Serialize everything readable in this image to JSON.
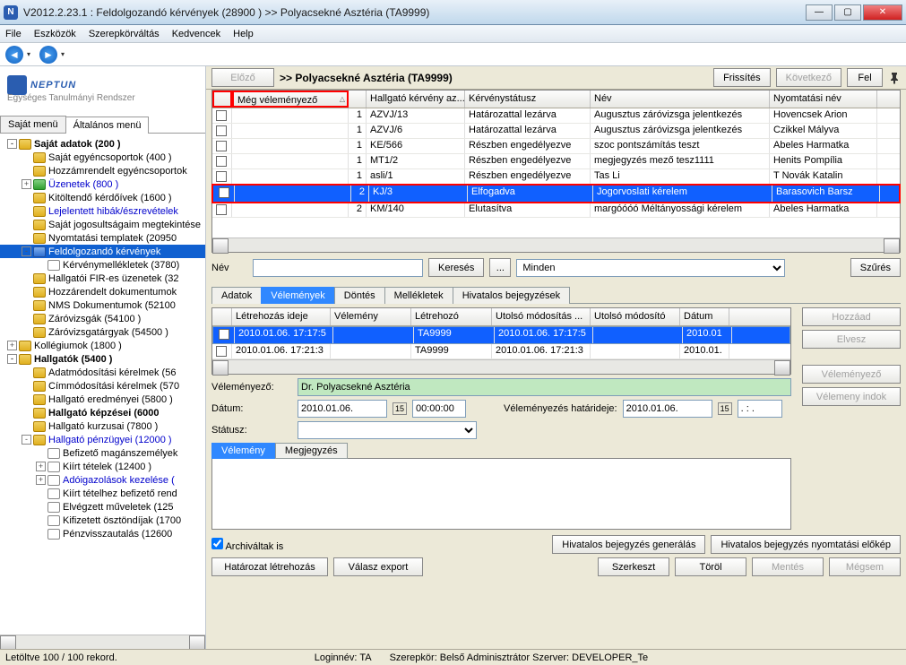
{
  "window": {
    "title": "V2012.2.23.1 : Feldolgozandó kérvények (28900  )  >> Polyacsekné Asztéria (TA9999)"
  },
  "menu": [
    "File",
    "Eszközök",
    "Szerepkörváltás",
    "Kedvencek",
    "Help"
  ],
  "logo": {
    "title": "NEPTUN",
    "sub": "Egységes Tanulmányi Rendszer"
  },
  "left_tabs": {
    "a": "Saját menü",
    "b": "Általános menü"
  },
  "tree": [
    {
      "d": 0,
      "exp": "-",
      "ico": "fld",
      "bold": true,
      "txt": "Saját adatok (200  )"
    },
    {
      "d": 1,
      "exp": "",
      "ico": "fld",
      "txt": "Saját egyéncsoportok (400  )"
    },
    {
      "d": 1,
      "exp": "",
      "ico": "fld",
      "txt": "Hozzámrendelt egyéncsoportok"
    },
    {
      "d": 1,
      "exp": "+",
      "ico": "green",
      "blue": true,
      "txt": "Üzenetek (800  )"
    },
    {
      "d": 1,
      "exp": "",
      "ico": "fld",
      "txt": "Kitöltendő kérdőívek (1600  )"
    },
    {
      "d": 1,
      "exp": "",
      "ico": "fld",
      "blue": true,
      "txt": "Lejelentett hibák/észrevételek"
    },
    {
      "d": 1,
      "exp": "",
      "ico": "fld",
      "txt": "Saját jogosultságaim megtekintése"
    },
    {
      "d": 1,
      "exp": "",
      "ico": "fld",
      "txt": "Nyomtatási templatek (20950"
    },
    {
      "d": 1,
      "exp": "-",
      "ico": "blue",
      "hl": true,
      "txt": "Feldolgozandó kérvények"
    },
    {
      "d": 2,
      "exp": "",
      "ico": "doc",
      "txt": "Kérvénymellékletek (3780)"
    },
    {
      "d": 1,
      "exp": "",
      "ico": "fld",
      "txt": "Hallgatói FIR-es üzenetek (32"
    },
    {
      "d": 1,
      "exp": "",
      "ico": "fld",
      "txt": "Hozzárendelt dokumentumok"
    },
    {
      "d": 1,
      "exp": "",
      "ico": "fld",
      "txt": "NMS Dokumentumok (52100"
    },
    {
      "d": 1,
      "exp": "",
      "ico": "fld",
      "txt": "Záróvizsgák (54100  )"
    },
    {
      "d": 1,
      "exp": "",
      "ico": "fld",
      "txt": "Záróvizsgatárgyak (54500  )"
    },
    {
      "d": 0,
      "exp": "+",
      "ico": "fld",
      "txt": "Kollégiumok (1800  )"
    },
    {
      "d": 0,
      "exp": "-",
      "ico": "fld",
      "bold": true,
      "txt": "Hallgatók (5400  )"
    },
    {
      "d": 1,
      "exp": "",
      "ico": "fld",
      "txt": "Adatmódosítási kérelmek (56"
    },
    {
      "d": 1,
      "exp": "",
      "ico": "fld",
      "txt": "Címmódosítási kérelmek (570"
    },
    {
      "d": 1,
      "exp": "",
      "ico": "fld",
      "txt": "Hallgató eredményei (5800  )"
    },
    {
      "d": 1,
      "exp": "",
      "ico": "fld",
      "bold": true,
      "txt": "Hallgató képzései (6000"
    },
    {
      "d": 1,
      "exp": "",
      "ico": "fld",
      "txt": "Hallgató kurzusai (7800  )"
    },
    {
      "d": 1,
      "exp": "-",
      "ico": "fld",
      "blue": true,
      "txt": "Hallgató pénzügyei (12000  )"
    },
    {
      "d": 2,
      "exp": "",
      "ico": "doc",
      "txt": "Befizető magánszemélyek"
    },
    {
      "d": 2,
      "exp": "+",
      "ico": "doc",
      "txt": "Kiírt tételek (12400  )"
    },
    {
      "d": 2,
      "exp": "+",
      "ico": "doc",
      "blue": true,
      "txt": "Adóigazolások kezelése ("
    },
    {
      "d": 2,
      "exp": "",
      "ico": "doc",
      "txt": "Kiírt tételhez befizető rend"
    },
    {
      "d": 2,
      "exp": "",
      "ico": "doc",
      "txt": "Elvégzett műveletek (125"
    },
    {
      "d": 2,
      "exp": "",
      "ico": "doc",
      "txt": "Kifizetett ösztöndíjak (1700"
    },
    {
      "d": 2,
      "exp": "",
      "ico": "doc",
      "txt": "Pénzvisszautalás (12600"
    }
  ],
  "top": {
    "prev": "Előző",
    "crumb": ">>  Polyacsekné Asztéria (TA9999)",
    "refresh": "Frissítés",
    "next": "Következő",
    "up": "Fel"
  },
  "grid": {
    "cols": [
      "",
      "Még véleményező",
      "",
      "Hallgató kérvény az...",
      "Kérvénystátusz",
      "Név",
      "Nyomtatási név"
    ],
    "rows": [
      [
        "",
        "",
        "1",
        "AZVJ/13",
        "Határozattal lezárva",
        "Augusztus záróvizsga jelentkezés",
        "Hovencsek Arion"
      ],
      [
        "",
        "",
        "1",
        "AZVJ/6",
        "Határozattal lezárva",
        "Augusztus záróvizsga jelentkezés",
        "Czikkel Mályva"
      ],
      [
        "",
        "",
        "1",
        "KE/566",
        "Részben engedélyezve",
        "szoc pontszámítás teszt",
        "Abeles Harmatka"
      ],
      [
        "",
        "",
        "1",
        "MT1/2",
        "Részben engedélyezve",
        "megjegyzés mező tesz1111",
        "Henits Pompília"
      ],
      [
        "",
        "",
        "1",
        "asli/1",
        "Részben engedélyezve",
        "Tas Li",
        "T Novák Katalin"
      ],
      [
        "",
        "",
        "2",
        "KJ/3",
        "Elfogadva",
        "Jogorvoslati kérelem",
        "Barasovich Barsz"
      ],
      [
        "",
        "",
        "2",
        "KM/140",
        "Elutasítva",
        "margóóóó Méltányossági kérelem",
        "Abeles Harmatka"
      ]
    ],
    "sel": 5
  },
  "search": {
    "lbl": "Név",
    "btn": "Keresés",
    "dots": "...",
    "drop": "Minden",
    "filter": "Szűrés"
  },
  "tabs2": [
    "Adatok",
    "Vélemények",
    "Döntés",
    "Mellékletek",
    "Hivatalos bejegyzések"
  ],
  "tabs2_active": 1,
  "inner_grid": {
    "cols": [
      "",
      "Létrehozás ideje",
      "Vélemény",
      "Létrehozó",
      "Utolsó módosítás ...",
      "Utolsó módosító",
      "Dátum"
    ],
    "rows": [
      [
        "",
        "2010.01.06. 17:17:5",
        "",
        "TA9999",
        "2010.01.06. 17:17:5",
        "",
        "2010.01"
      ],
      [
        "",
        "2010.01.06. 17:21:3",
        "",
        "TA9999",
        "2010.01.06. 17:21:3",
        "",
        "2010.01."
      ]
    ],
    "sel": 0
  },
  "side_btns": [
    "Hozzáad",
    "Elvesz",
    "Véleményező",
    "Vélemeny indok"
  ],
  "form": {
    "velemenyezo_lbl": "Véleményező:",
    "velemenyezo_val": "Dr. Polyacsekné Asztéria",
    "datum_lbl": "Dátum:",
    "datum_val": "2010.01.06.",
    "time_val": "00:00:00",
    "hatarido_lbl": "Véleményezés határideje:",
    "hatarido_val": "2010.01.06.",
    "hatarido_time": ". : .",
    "statusz_lbl": "Státusz:"
  },
  "note_tabs": [
    "Vélemény",
    "Megjegyzés"
  ],
  "arch": "Archiváltak is",
  "bottom_btns": {
    "gen": "Hivatalos bejegyzés generálás",
    "print": "Hivatalos bejegyzés nyomtatási előkép",
    "hatarozat": "Határozat létrehozás",
    "export": "Válasz export",
    "szerk": "Szerkeszt",
    "torol": "Töröl",
    "mentes": "Mentés",
    "megsem": "Mégsem"
  },
  "status": {
    "records": "Letöltve 100 / 100 rekord.",
    "login": "Loginnév: TA",
    "role": "Szerepkör: Belső Adminisztrátor   Szerver: DEVELOPER_Te"
  }
}
